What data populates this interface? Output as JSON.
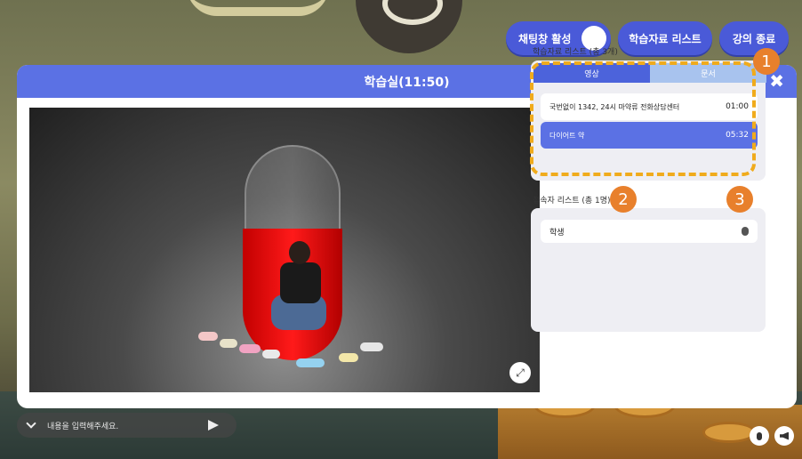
{
  "top_buttons": {
    "chat_toggle_label": "채팅창 활성",
    "materials_list_label": "학습자료 리스트",
    "end_lecture_label": "강의 종료"
  },
  "modal": {
    "title": "학습실(11:50)",
    "close_icon": "close-icon"
  },
  "materials": {
    "title": "학습자료 리스트 (총 3개)",
    "tabs": [
      {
        "label": "영상",
        "active": true
      },
      {
        "label": "문서",
        "active": false
      }
    ],
    "items": [
      {
        "title": "국번없이 1342, 24시 마약류 전화상담센터",
        "duration": "01:00"
      },
      {
        "title": "다이어트 약",
        "duration": "05:32"
      }
    ]
  },
  "connected": {
    "title": "접속자 리스트 (총 1명)",
    "users": [
      {
        "name": "학생",
        "icon": "microphone-icon"
      }
    ]
  },
  "badges": [
    "1",
    "2",
    "3"
  ],
  "chat": {
    "placeholder": "내용을 입력해주세요."
  },
  "colors": {
    "primary": "#5b71e4",
    "accent": "#f0ab1c",
    "badge": "#e8802c"
  }
}
